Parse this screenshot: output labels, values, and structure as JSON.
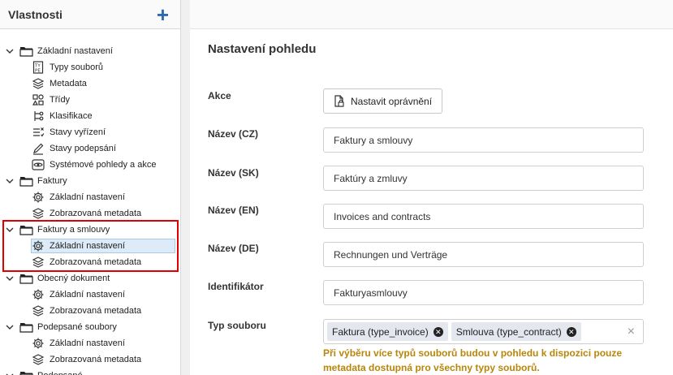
{
  "sidebar": {
    "title": "Vlastnosti",
    "add_label": "+",
    "items": [
      {
        "label": "Základní nastavení",
        "level": 0,
        "icon": "folder-icon",
        "chevron": "down"
      },
      {
        "label": "Typy souborů",
        "level": 1,
        "icon": "file-type-icon"
      },
      {
        "label": "Metadata",
        "level": 1,
        "icon": "layers-icon"
      },
      {
        "label": "Třídy",
        "level": 1,
        "icon": "classes-icon"
      },
      {
        "label": "Klasifikace",
        "level": 1,
        "icon": "classification-icon"
      },
      {
        "label": "Stavy vyřízení",
        "level": 1,
        "icon": "status-list-icon"
      },
      {
        "label": "Stavy podepsání",
        "level": 1,
        "icon": "pen-icon"
      },
      {
        "label": "Systémové pohledy a akce",
        "level": 1,
        "icon": "eye-icon"
      },
      {
        "label": "Faktury",
        "level": 0,
        "icon": "folder-icon",
        "chevron": "down"
      },
      {
        "label": "Základní nastavení",
        "level": 1,
        "icon": "gear-icon"
      },
      {
        "label": "Zobrazovaná metadata",
        "level": 1,
        "icon": "layers-icon"
      },
      {
        "label": "Faktury a smlouvy",
        "level": 0,
        "icon": "folder-icon",
        "chevron": "down"
      },
      {
        "label": "Základní nastavení",
        "level": 1,
        "icon": "gear-icon",
        "selected": true
      },
      {
        "label": "Zobrazovaná metadata",
        "level": 1,
        "icon": "layers-icon"
      },
      {
        "label": "Obecný dokument",
        "level": 0,
        "icon": "folder-icon",
        "chevron": "down"
      },
      {
        "label": "Základní nastavení",
        "level": 1,
        "icon": "gear-icon"
      },
      {
        "label": "Zobrazovaná metadata",
        "level": 1,
        "icon": "layers-icon"
      },
      {
        "label": "Podepsané soubory",
        "level": 0,
        "icon": "folder-icon",
        "chevron": "down"
      },
      {
        "label": "Základní nastavení",
        "level": 1,
        "icon": "gear-icon"
      },
      {
        "label": "Zobrazovaná metadata",
        "level": 1,
        "icon": "layers-icon"
      },
      {
        "label": "Podepsané",
        "level": 0,
        "icon": "folder-icon",
        "chevron": "down"
      }
    ]
  },
  "main": {
    "title": "Nastavení pohledu",
    "action_label": "Akce",
    "action_button": "Nastavit oprávnění",
    "fields": [
      {
        "label": "Název (CZ)",
        "value": "Faktury a smlouvy"
      },
      {
        "label": "Název (SK)",
        "value": "Faktúry a zmluvy"
      },
      {
        "label": "Název (EN)",
        "value": "Invoices and contracts"
      },
      {
        "label": "Název (DE)",
        "value": "Rechnungen und Verträge"
      },
      {
        "label": "Identifikátor",
        "value": "Fakturyasmlouvy"
      }
    ],
    "file_type_label": "Typ souboru",
    "file_types": [
      {
        "label": "Faktura (type_invoice)"
      },
      {
        "label": "Smlouva (type_contract)"
      }
    ],
    "clear_label": "×",
    "warning": "Při výběru více typů souborů budou v pohledu k dispozici pouze metadata dostupná pro všechny typy souborů."
  },
  "colors": {
    "accent": "#2b6cb0",
    "highlight": "#e00000",
    "warning": "#b8860b",
    "selected_bg": "#dcebf7"
  }
}
